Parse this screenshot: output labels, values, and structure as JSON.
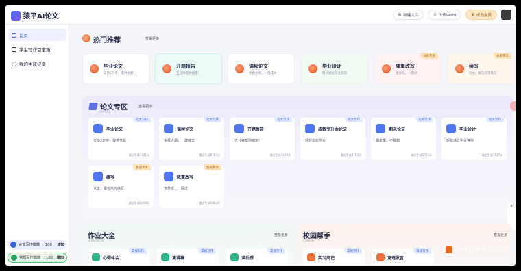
{
  "app": {
    "name": "猿平AI论文"
  },
  "top_actions": {
    "new_doc": "新建文件",
    "upload": "上传Word",
    "member": "成为会员"
  },
  "sidebar": {
    "items": [
      {
        "label": "首页"
      },
      {
        "label": "学生写作百宝箱"
      },
      {
        "label": "我的生成记录"
      }
    ],
    "quota": [
      {
        "label": "论文写作篇数",
        "value": "100",
        "action": "增加"
      },
      {
        "label": "常规写作篇数",
        "value": "100",
        "action": "增加"
      }
    ]
  },
  "hot": {
    "title": "热门推荐",
    "more": "查看更多",
    "cards": [
      {
        "name": "毕业论文",
        "desc": "支持2万字，提供文献",
        "badge": ""
      },
      {
        "name": "开题报告",
        "desc": "五分钟帮你搞定!",
        "badge": ""
      },
      {
        "name": "课程论文",
        "desc": "免费大纲，一键成文",
        "badge": ""
      },
      {
        "name": "毕业设计",
        "desc": "轻松通过毕业答辩",
        "badge": ""
      },
      {
        "name": "降重改写",
        "desc": "查重低，一网过",
        "badge": "会员专享"
      },
      {
        "name": "续写",
        "desc": "论文、报告均可续写",
        "badge": "会员专享"
      }
    ]
  },
  "paper_zone": {
    "title": "论文专区",
    "subtitle": "PAPERS",
    "more": "查看更多",
    "cards": [
      {
        "name": "毕业论文",
        "desc": "支持2万字，提供文献",
        "count": "最近生成7831次",
        "badge": "论文写作"
      },
      {
        "name": "课程论文",
        "desc": "免费大纲，一键成文",
        "count": "最近生成8763次",
        "badge": "论文写作"
      },
      {
        "name": "开题报告",
        "desc": "五分钟帮你搞定!",
        "count": "最近生成7849次",
        "badge": "论文写作"
      },
      {
        "name": "成教专升本论文",
        "desc": "轻轻松松毕业",
        "count": "最近生成4763次",
        "badge": "论文写作"
      },
      {
        "name": "期末论文",
        "desc": "期末季，不费劲",
        "count": "最近生成2750次",
        "badge": "论文写作"
      },
      {
        "name": "毕业设计",
        "desc": "轻松通过毕业答辩",
        "count": "最近生成7817次",
        "badge": "论文写作"
      },
      {
        "name": "续写",
        "desc": "论文、报告均可续写",
        "count": "最近生成6008次",
        "badge": "会员专享"
      },
      {
        "name": "降重改写",
        "desc": "查重低，一网过",
        "count": "最近生成5803次",
        "badge": "会员专享"
      }
    ]
  },
  "homework": {
    "title": "作业大全",
    "subtitle": "HOMEWORK",
    "more": "查看更多",
    "cards": [
      {
        "name": "心得体会",
        "badge": "常规写作"
      },
      {
        "name": "演讲稿",
        "badge": "常规写作"
      },
      {
        "name": "读后感",
        "badge": "常规写作"
      }
    ]
  },
  "campus": {
    "title": "校园帮手",
    "subtitle": "CAMPUS",
    "more": "查看更多",
    "cards": [
      {
        "name": "实习周记",
        "badge": "常规写作"
      },
      {
        "name": "竞选发言",
        "badge": "常规写作"
      }
    ]
  },
  "overlay": {
    "text": "A 9 9 I 8 8 9"
  },
  "colors": {
    "accent": "#2f5ff4",
    "member": "#fde6c3",
    "hot": "#e4552b"
  }
}
